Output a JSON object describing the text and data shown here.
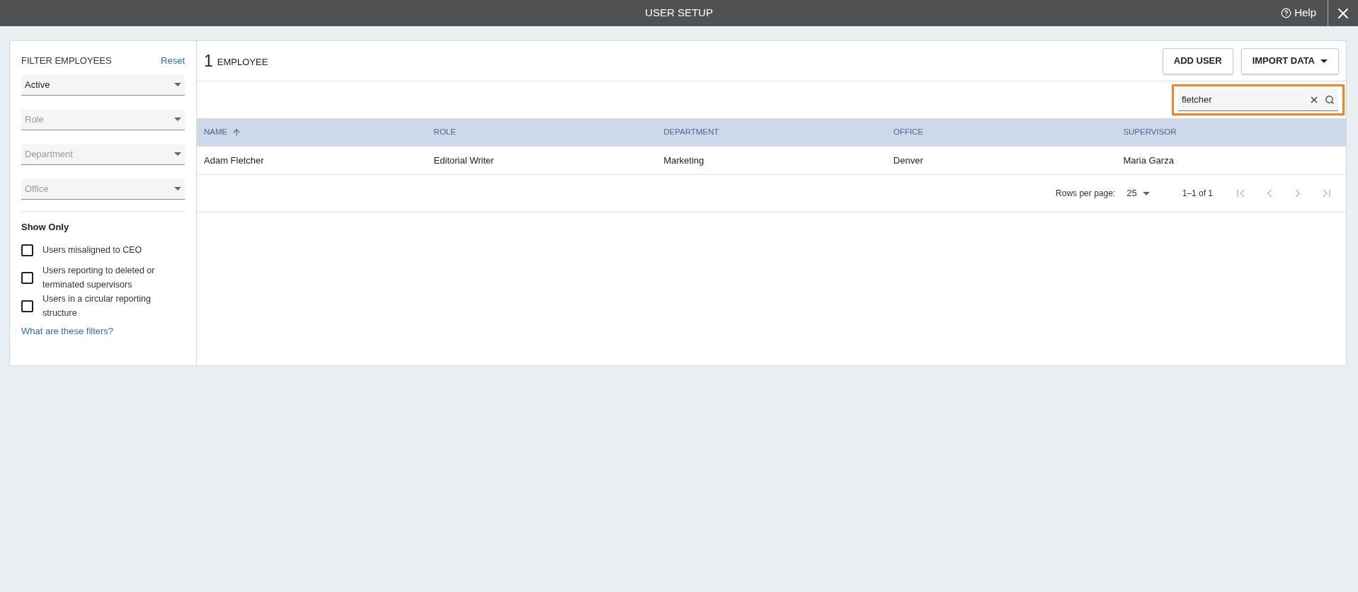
{
  "window": {
    "title": "USER SETUP",
    "help": "Help"
  },
  "filters": {
    "title": "FILTER EMPLOYEES",
    "reset": "Reset",
    "selects": [
      {
        "value": "Active"
      },
      {
        "placeholder": "Role"
      },
      {
        "placeholder": "Department"
      },
      {
        "placeholder": "Office"
      }
    ],
    "show_only": {
      "title": "Show Only",
      "options": [
        {
          "label": "Users misaligned to CEO",
          "checked": false
        },
        {
          "label": "Users reporting to deleted or terminated supervisors",
          "checked": false
        },
        {
          "label": "Users in a circular reporting structure",
          "checked": false
        }
      ]
    },
    "help_link": "What are these filters?"
  },
  "count": {
    "number": "1",
    "label": "EMPLOYEE"
  },
  "buttons": [
    {
      "label": "ADD USER",
      "kind": "plain"
    },
    {
      "label": "IMPORT DATA",
      "kind": "dropdown"
    }
  ],
  "search": {
    "value": "fletcher",
    "focused": true
  },
  "table": {
    "columns": [
      {
        "label": "NAME",
        "sorted": true
      },
      {
        "label": "ROLE",
        "sorted": false
      },
      {
        "label": "DEPARTMENT",
        "sorted": false
      },
      {
        "label": "OFFICE",
        "sorted": false
      },
      {
        "label": "SUPERVISOR",
        "sorted": false
      }
    ],
    "rows": [
      [
        "Adam Fletcher",
        "Editorial Writer",
        "Marketing",
        "Denver",
        "Maria Garza"
      ]
    ]
  },
  "pagination": {
    "rows_label": "Rows per page:",
    "rows_value": "25",
    "range": "1–1 of 1",
    "controls": [
      {
        "kind": "first",
        "disabled": true
      },
      {
        "kind": "prev",
        "disabled": true
      },
      {
        "kind": "next",
        "disabled": true
      },
      {
        "kind": "last",
        "disabled": true
      }
    ]
  }
}
